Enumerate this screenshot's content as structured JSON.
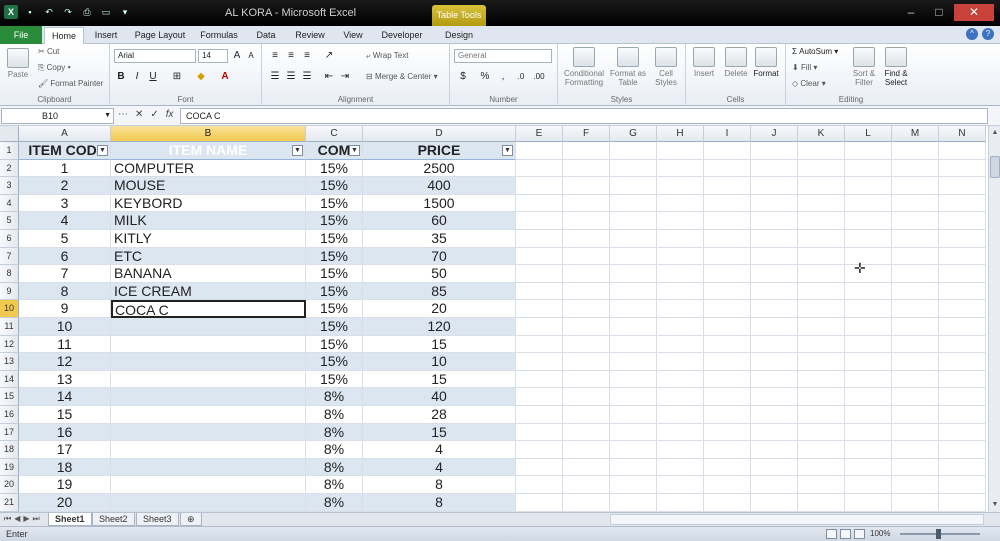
{
  "window": {
    "title": "AL KORA  -  Microsoft Excel",
    "contextual_tab": "Table Tools"
  },
  "tabs": [
    "File",
    "Home",
    "Insert",
    "Page Layout",
    "Formulas",
    "Data",
    "Review",
    "View",
    "Developer",
    "Design"
  ],
  "ribbon": {
    "clipboard": {
      "paste": "Paste",
      "cut": "Cut",
      "copy": "Copy",
      "format_painter": "Format Painter",
      "label": "Clipboard"
    },
    "font": {
      "name": "Arial",
      "size": "14",
      "label": "Font"
    },
    "alignment": {
      "wrap": "Wrap Text",
      "merge": "Merge & Center",
      "label": "Alignment"
    },
    "number": {
      "format": "General",
      "label": "Number"
    },
    "styles": {
      "conditional": "Conditional Formatting",
      "format_table": "Format as Table",
      "cell_styles": "Cell Styles",
      "label": "Styles"
    },
    "cells": {
      "insert": "Insert",
      "delete": "Delete",
      "format": "Format",
      "label": "Cells"
    },
    "editing": {
      "autosum": "AutoSum",
      "fill": "Fill",
      "clear": "Clear",
      "sort": "Sort & Filter",
      "find": "Find & Select",
      "label": "Editing"
    }
  },
  "formula_bar": {
    "name_box": "B10",
    "fx": "fx",
    "value": "COCA C"
  },
  "columns": [
    "A",
    "B",
    "C",
    "D",
    "E",
    "F",
    "G",
    "H",
    "I",
    "J",
    "K",
    "L",
    "M",
    "N"
  ],
  "active_column": "B",
  "active_row": 10,
  "table": {
    "headers": [
      "ITEM CODI",
      "ITEM NAME",
      "COM",
      "PRICE"
    ],
    "rows": [
      [
        "1",
        "COMPUTER",
        "15%",
        "2500"
      ],
      [
        "2",
        "MOUSE",
        "15%",
        "400"
      ],
      [
        "3",
        "KEYBORD",
        "15%",
        "1500"
      ],
      [
        "4",
        "MILK",
        "15%",
        "60"
      ],
      [
        "5",
        "KITLY",
        "15%",
        "35"
      ],
      [
        "6",
        "ETC",
        "15%",
        "70"
      ],
      [
        "7",
        "BANANA",
        "15%",
        "50"
      ],
      [
        "8",
        "ICE CREAM",
        "15%",
        "85"
      ],
      [
        "9",
        "COCA C",
        "15%",
        "20"
      ],
      [
        "10",
        "",
        "15%",
        "120"
      ],
      [
        "11",
        "",
        "15%",
        "15"
      ],
      [
        "12",
        "",
        "15%",
        "10"
      ],
      [
        "13",
        "",
        "15%",
        "15"
      ],
      [
        "14",
        "",
        "8%",
        "40"
      ],
      [
        "15",
        "",
        "8%",
        "28"
      ],
      [
        "16",
        "",
        "8%",
        "15"
      ],
      [
        "17",
        "",
        "8%",
        "4"
      ],
      [
        "18",
        "",
        "8%",
        "4"
      ],
      [
        "19",
        "",
        "8%",
        "8"
      ],
      [
        "20",
        "",
        "8%",
        "8"
      ]
    ]
  },
  "sheets": [
    "Sheet1",
    "Sheet2",
    "Sheet3"
  ],
  "active_sheet": "Sheet1",
  "status": {
    "mode": "Enter",
    "zoom": "100%"
  },
  "colors": {
    "file_tab": "#2a8b3a",
    "table_band": "#dce6f1",
    "active_header": "#f1c94e"
  }
}
